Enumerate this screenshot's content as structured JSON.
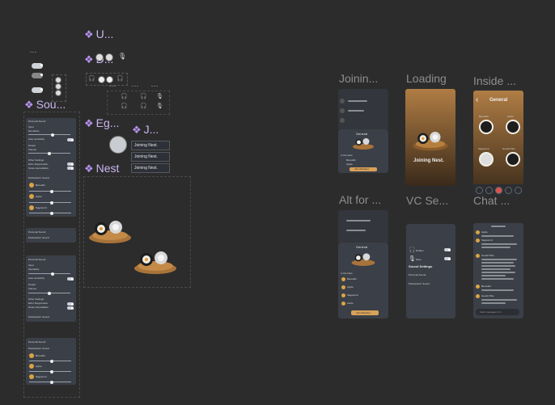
{
  "components": {
    "u_title": "U...",
    "d_title": "D...",
    "sound_title": "Sou...",
    "eg_title": "Eg...",
    "j_title": "J...",
    "nest_title": "Nest",
    "top_dash": "---"
  },
  "joining_chips": [
    "Joining Nest.",
    "Joining Nest.",
    "Joining Nest."
  ],
  "frames": {
    "joining": "Joinin...",
    "loading": "Loading",
    "inside": "Inside ...",
    "alt_for": "Alt for ...",
    "vc_settings": "VC Se...",
    "chat": "Chat ..."
  },
  "sound_panel": {
    "personal_sound": "Personal Sound",
    "input": "Input",
    "sensitivity": "Sensitivity",
    "auto_sensitivity": "Auto sensitivity",
    "output": "Output",
    "volume": "Volume",
    "other_settings": "Other Settings",
    "echo_suppression": "Echo Suppression",
    "noise_cancellation": "Noise Cancellation",
    "participants_sound": "Participants' Sound",
    "participants": [
      "Benedikt",
      "Apple",
      "Sagoword"
    ]
  },
  "loading_screen": {
    "text": "Joining Nest."
  },
  "inside_screen": {
    "title": "General",
    "members": [
      "Benedikt",
      "Kanto",
      "Sagoword",
      "Goodd Plus"
    ]
  },
  "joining_screen": {
    "general_title": "General",
    "in_the_nest": "In the Nest",
    "participants": [
      "Benedikt",
      "Apple",
      "Sagoword",
      "Kanto"
    ],
    "join_button": "Join Channel"
  },
  "vc_screen": {
    "headphones": "Deafen",
    "mute": "Mute",
    "sound_settings": "Sound Settings",
    "personal_sound": "Personal Sound",
    "participants_sound": "Participants' Sound"
  },
  "chat_screen": {
    "senders": [
      "Apple",
      "Sagoword",
      "Goodd Plus",
      "Benedikt",
      "Goodd Plus"
    ],
    "input_placeholder": "Send message in #..."
  },
  "colors": {
    "background": "#2c2c2c",
    "panel": "#3b3f47",
    "accent_purple": "#b893f0",
    "loading_top": "#b07d44",
    "loading_bottom": "#3a2a1a",
    "join_button": "#d8a25a"
  }
}
